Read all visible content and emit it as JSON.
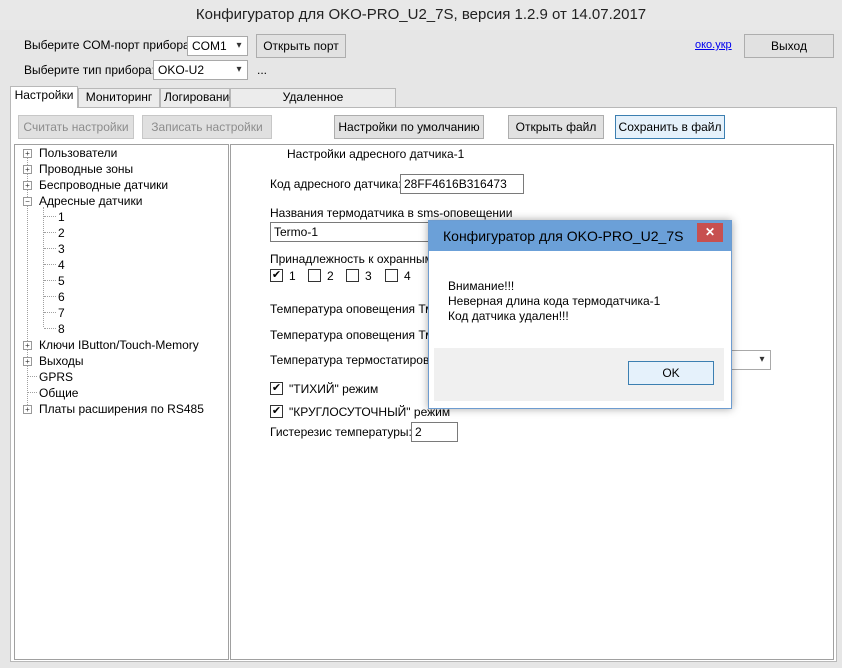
{
  "window": {
    "title": "Конфигуратор для OKO-PRO_U2_7S, версия 1.2.9 от 14.07.2017"
  },
  "header": {
    "com_label": "Выберите СОМ-порт прибора:",
    "com_value": "COM1",
    "open_port": "Открыть порт",
    "device_label": "Выберите тип прибора:",
    "device_value": "OKO-U2",
    "ellipsis": "...",
    "site_link": "око.укр",
    "exit": "Выход"
  },
  "tabs": [
    "Настройки",
    "Мониторинг",
    "Логирование",
    "Удаленное конфигурирование"
  ],
  "toolbar": {
    "read": "Считать настройки",
    "write": "Записать настройки",
    "defaults": "Настройки по умолчанию",
    "open_file": "Открыть файл",
    "save_file": "Сохранить в файл"
  },
  "tree": {
    "users": "Пользователи",
    "wired": "Проводные зоны",
    "wireless": "Беспроводные датчики",
    "address": "Адресные датчики",
    "sub": [
      "1",
      "2",
      "3",
      "4",
      "5",
      "6",
      "7",
      "8"
    ],
    "keys": "Ключи IButton/Touch-Memory",
    "outputs": "Выходы",
    "gprs": "GPRS",
    "general": "Общие",
    "expansion": "Платы расширения по RS485"
  },
  "panel": {
    "heading": "Настройки адресного датчика-1",
    "code_label": "Код адресного датчика:",
    "code_value": "28FF4616B316473",
    "name_label": "Названия термодатчика в sms-оповещении",
    "name_value": "Termo-1",
    "zone_label": "Принадлежность к охранным г",
    "zones": [
      "1",
      "2",
      "3",
      "4"
    ],
    "temp_min": "Температура оповещения Тмин",
    "temp_max": "Температура оповещения Тмак",
    "temp_therm": "Температура термостатирован",
    "quiet": "\"ТИХИЙ\" режим",
    "round": "\"КРУГЛОСУТОЧНЫЙ\" режим",
    "hyst_label": "Гистерезис температуры:",
    "hyst_value": "2"
  },
  "dialog": {
    "title": "Конфигуратор для OKO-PRO_U2_7S",
    "line1": "Внимание!!!",
    "line2": "Неверная длина кода термодатчика-1",
    "line3": "Код датчика удален!!!",
    "ok": "OK",
    "close": "✕"
  },
  "icons": {
    "expand": "plus-box",
    "collapse": "minus-box",
    "dropdown": "chevron-down",
    "check": "check-mark"
  }
}
